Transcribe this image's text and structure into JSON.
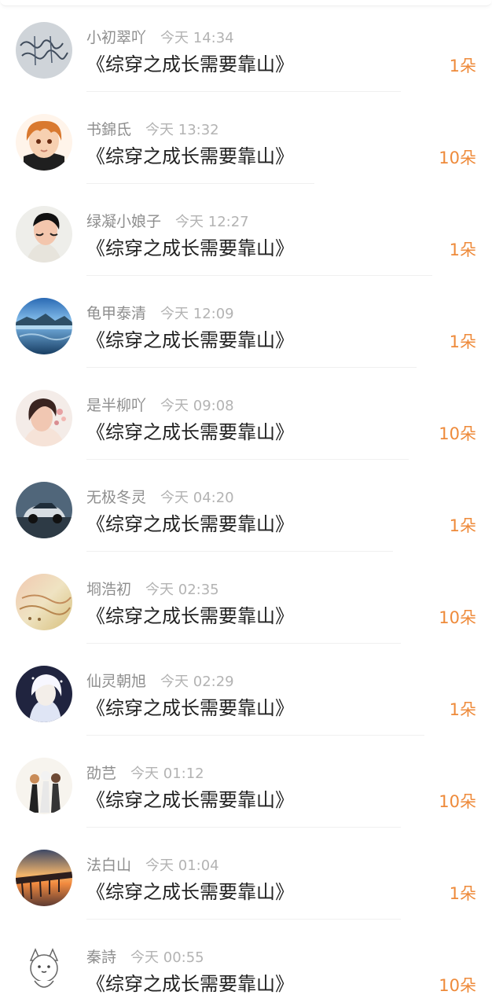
{
  "gifts": [
    {
      "name": "小初翠吖",
      "time": "今天  14:34",
      "book": "《综穿之成长需要靠山》",
      "amount": "1朵",
      "avatar": "handwriting-avatar"
    },
    {
      "name": "书錦氐",
      "time": "今天  13:32",
      "book": "《综穿之成长需要靠山》",
      "amount": "10朵",
      "avatar": "anime-boy-avatar"
    },
    {
      "name": "绿凝小娘子",
      "time": "今天  12:27",
      "book": "《综穿之成长需要靠山》",
      "amount": "1朵",
      "avatar": "young-man-avatar"
    },
    {
      "name": "龟甲泰清",
      "time": "今天  12:09",
      "book": "《综穿之成长需要靠山》",
      "amount": "1朵",
      "avatar": "lake-mountains-avatar"
    },
    {
      "name": "是半柳吖",
      "time": "今天  09:08",
      "book": "《综穿之成长需要靠山》",
      "amount": "10朵",
      "avatar": "girl-flowers-avatar"
    },
    {
      "name": "无极冬灵",
      "time": "今天  04:20",
      "book": "《综穿之成长需要靠山》",
      "amount": "1朵",
      "avatar": "car-avatar"
    },
    {
      "name": "埛浩初",
      "time": "今天  02:35",
      "book": "《综穿之成长需要靠山》",
      "amount": "10朵",
      "avatar": "vintage-paper-avatar"
    },
    {
      "name": "仙灵朝旭",
      "time": "今天  02:29",
      "book": "《综穿之成长需要靠山》",
      "amount": "1朵",
      "avatar": "white-hair-anime-avatar"
    },
    {
      "name": "劭芑",
      "time": "今天  01:12",
      "book": "《综穿之成长需要靠山》",
      "amount": "10朵",
      "avatar": "group-anime-avatar"
    },
    {
      "name": "法白山",
      "time": "今天  01:04",
      "book": "《综穿之成长需要靠山》",
      "amount": "1朵",
      "avatar": "pier-sunset-avatar"
    },
    {
      "name": "秦詩",
      "time": "今天  00:55",
      "book": "《综穿之成长需要靠山》",
      "amount": "10朵",
      "avatar": "cartoon-cat-avatar"
    }
  ],
  "colors": {
    "amount": "#ee8a3a",
    "title": "#222222",
    "username": "#8e8e8e",
    "time": "#b3b3b3"
  }
}
